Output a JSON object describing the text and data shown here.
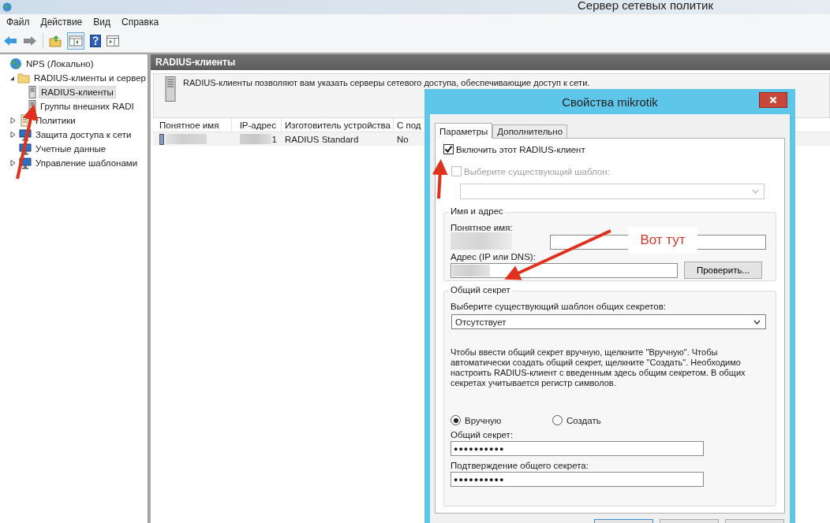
{
  "window": {
    "title": "Сервер сетевых политик"
  },
  "menu": [
    "Файл",
    "Действие",
    "Вид",
    "Справка"
  ],
  "tree": [
    {
      "label": "NPS (Локально)",
      "selected": false,
      "children": [
        {
          "label": "RADIUS-клиенты и сервер",
          "expanded": true,
          "selected": false,
          "children": [
            {
              "label": "RADIUS-клиенты",
              "selected": true
            },
            {
              "label": "Группы внешних RADI",
              "selected": false
            }
          ]
        },
        {
          "label": "Политики",
          "expanded": false,
          "selected": false
        },
        {
          "label": "Защита доступа к сети",
          "expanded": false,
          "selected": false
        },
        {
          "label": "Учетные данные",
          "selected": false
        },
        {
          "label": "Управление шаблонами",
          "expanded": false,
          "selected": false
        }
      ]
    }
  ],
  "panel": {
    "title": "RADIUS-клиенты",
    "description": "RADIUS-клиенты позволяют вам указать серверы сетевого доступа, обеспечивающие доступ к сети."
  },
  "table": {
    "columns": [
      "Понятное имя",
      "IP-адрес",
      "Изготовитель устройства",
      "С под"
    ],
    "rows": [
      {
        "ip_address": "1",
        "vendor": "RADIUS Standard",
        "column_4": "No"
      }
    ]
  },
  "dialog": {
    "title": "Свойства mikrotik",
    "tabs": [
      {
        "label": "Параметры",
        "selected": true
      },
      {
        "label": "Дополнительно",
        "selected": false
      }
    ],
    "enable_checkbox": {
      "label": "Включить этот RADIUS-клиент",
      "checked": true
    },
    "template_checkbox": {
      "label": "Выберите существующий шаблон:",
      "checked": false,
      "disabled": true
    },
    "name_group": {
      "title": "Имя и адрес",
      "name_label": "Понятное имя:",
      "address_label": "Адрес (IP или DNS):",
      "verify_button": "Проверить..."
    },
    "secret_group": {
      "title": "Общий секрет",
      "template_label": "Выберите существующий шаблон общих секретов:",
      "template_value": "Отсутствует",
      "help": "Чтобы ввести общий секрет вручную, щелкните \"Вручную\". Чтобы автоматически создать общий секрет, щелкните \"Создать\". Необходимо настроить RADIUS-клиент с введенным здесь общим секретом. В общих секретах учитывается регистр символов.",
      "radios": [
        {
          "label": "Вручную",
          "selected": true
        },
        {
          "label": "Создать",
          "selected": false
        }
      ],
      "secret_label": "Общий секрет:",
      "secret_value": "●●●●●●●●●●",
      "confirm_label": "Подтверждение общего секрета:",
      "confirm_value": "●●●●●●●●●●"
    }
  },
  "callout": "Вот тут"
}
